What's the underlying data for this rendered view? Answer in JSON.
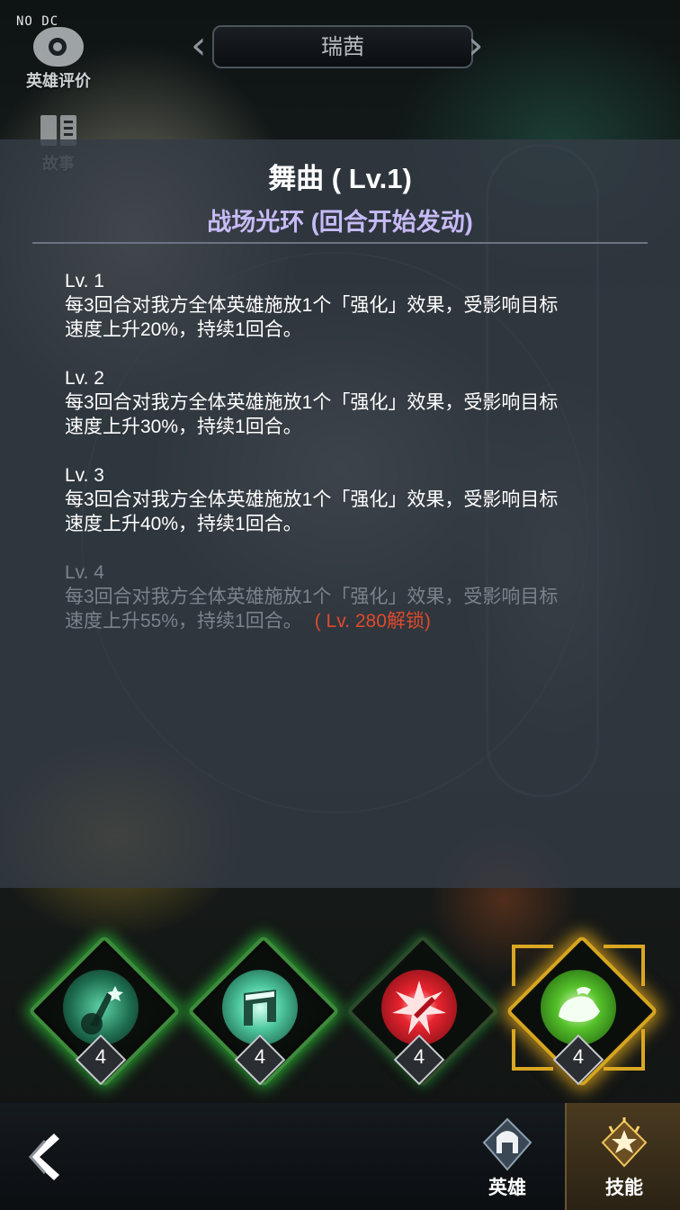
{
  "header": {
    "watermark": "NO DC",
    "hero_name": "瑞茜",
    "eval_label": "英雄评价",
    "story_label": "故事"
  },
  "skill": {
    "title": "舞曲 ( Lv.1)",
    "type": "战场光环 (回合开始发动)",
    "levels": [
      {
        "title": "Lv. 1",
        "desc_line1": "每3回合对我方全体英雄施放1个「强化」效果，受影响目标",
        "desc_line2": "速度上升20%，持续1回合。"
      },
      {
        "title": "Lv. 2",
        "desc_line1": "每3回合对我方全体英雄施放1个「强化」效果，受影响目标",
        "desc_line2": "速度上升30%，持续1回合。"
      },
      {
        "title": "Lv. 3",
        "desc_line1": "每3回合对我方全体英雄施放1个「强化」效果，受影响目标",
        "desc_line2": "速度上升40%，持续1回合。"
      },
      {
        "title": "Lv. 4",
        "desc_line1": "每3回合对我方全体英雄施放1个「强化」效果，受影响目标",
        "desc_line2": "速度上升55%，持续1回合。",
        "unlock_note": "( Lv. 280解锁)",
        "locked": true
      }
    ]
  },
  "skill_icons": [
    {
      "icon": "guitar-skill-icon",
      "level": "4",
      "selected": false
    },
    {
      "icon": "music-note-skill-icon",
      "level": "4",
      "selected": false
    },
    {
      "icon": "burst-skill-icon",
      "level": "4",
      "selected": false
    },
    {
      "icon": "dance-shoe-skill-icon",
      "level": "4",
      "selected": true
    }
  ],
  "nav": {
    "hero_label": "英雄",
    "skill_label": "技能",
    "active": "skill"
  },
  "colors": {
    "panel_bg": "#343c46",
    "subtitle": "#c6bbf7",
    "locked_text": "#7a828b",
    "unlock_note": "#e04a2c",
    "green_glow": "#32d23c",
    "gold_frame": "#d9a723"
  }
}
